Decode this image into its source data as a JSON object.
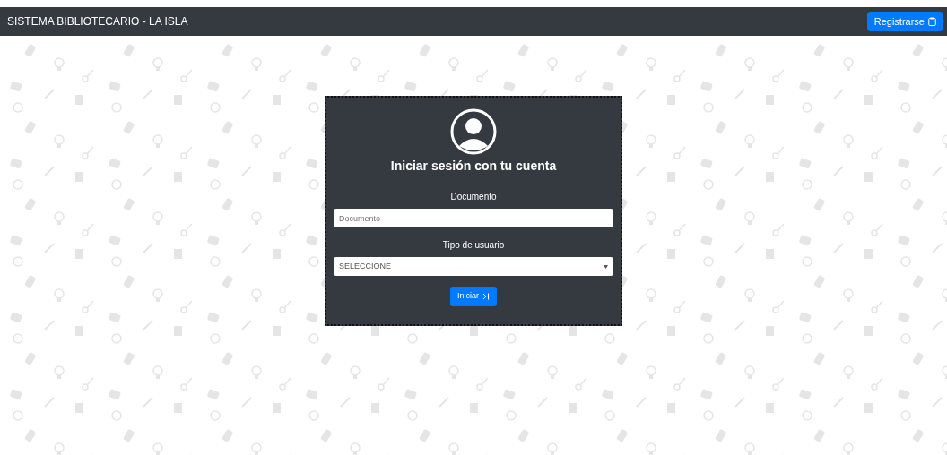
{
  "navbar": {
    "title": "SISTEMA BIBLIOTECARIO - LA ISLA",
    "register_button": "Registrarse"
  },
  "login": {
    "heading": "Iniciar sesión con tu cuenta",
    "fields": [
      {
        "kind": "text",
        "label": "Documento",
        "placeholder": "Documento"
      },
      {
        "kind": "select",
        "label": "Tipo de usuario",
        "value": "SELECCIONE"
      }
    ],
    "submit": "Iniciar"
  }
}
